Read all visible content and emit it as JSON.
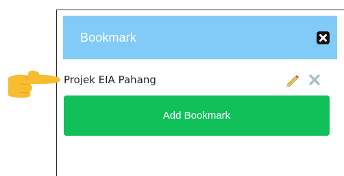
{
  "panel": {
    "title": "Bookmark",
    "close_icon": "close-square-icon"
  },
  "bookmarks": [
    {
      "label": "Projek EIA Pahang",
      "edit_icon": "pencil-icon",
      "delete_icon": "x-icon"
    }
  ],
  "add_button": {
    "label": "Add Bookmark"
  },
  "pointer_icon": "pointing-hand-icon",
  "colors": {
    "header_bg": "#82caf8",
    "add_button_bg": "#10c15a",
    "delete_icon": "#a9bfcb",
    "hand": "#f6bd31"
  }
}
